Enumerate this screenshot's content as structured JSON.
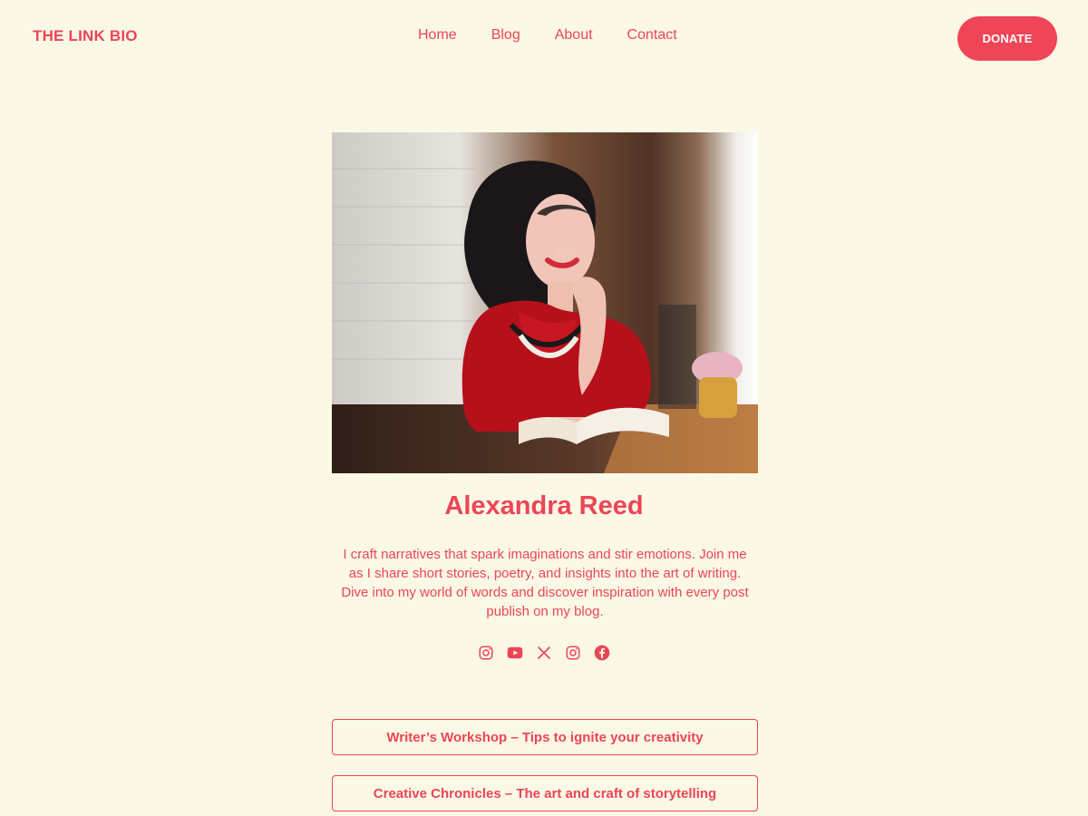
{
  "site": {
    "title": "THE LINK BIO"
  },
  "nav": {
    "items": [
      {
        "label": "Home"
      },
      {
        "label": "Blog"
      },
      {
        "label": "About"
      },
      {
        "label": "Contact"
      }
    ]
  },
  "header": {
    "donate_label": "DONATE"
  },
  "profile": {
    "name": "Alexandra Reed",
    "bio": "I craft narratives that spark imaginations and stir emotions. Join me as I share short stories, poetry, and insights into the art of writing. Dive into my world of words and discover inspiration with every post publish on my blog."
  },
  "social": {
    "icons": [
      "instagram-icon",
      "youtube-icon",
      "x-icon",
      "instagram-icon",
      "facebook-icon"
    ]
  },
  "links": [
    {
      "label": "Writer’s Workshop – Tips to ignite your creativity"
    },
    {
      "label": "Creative Chronicles – The art and craft of storytelling"
    }
  ],
  "colors": {
    "background": "#fbf8e5",
    "accent": "#ec4558",
    "button_text": "#ffffff"
  }
}
